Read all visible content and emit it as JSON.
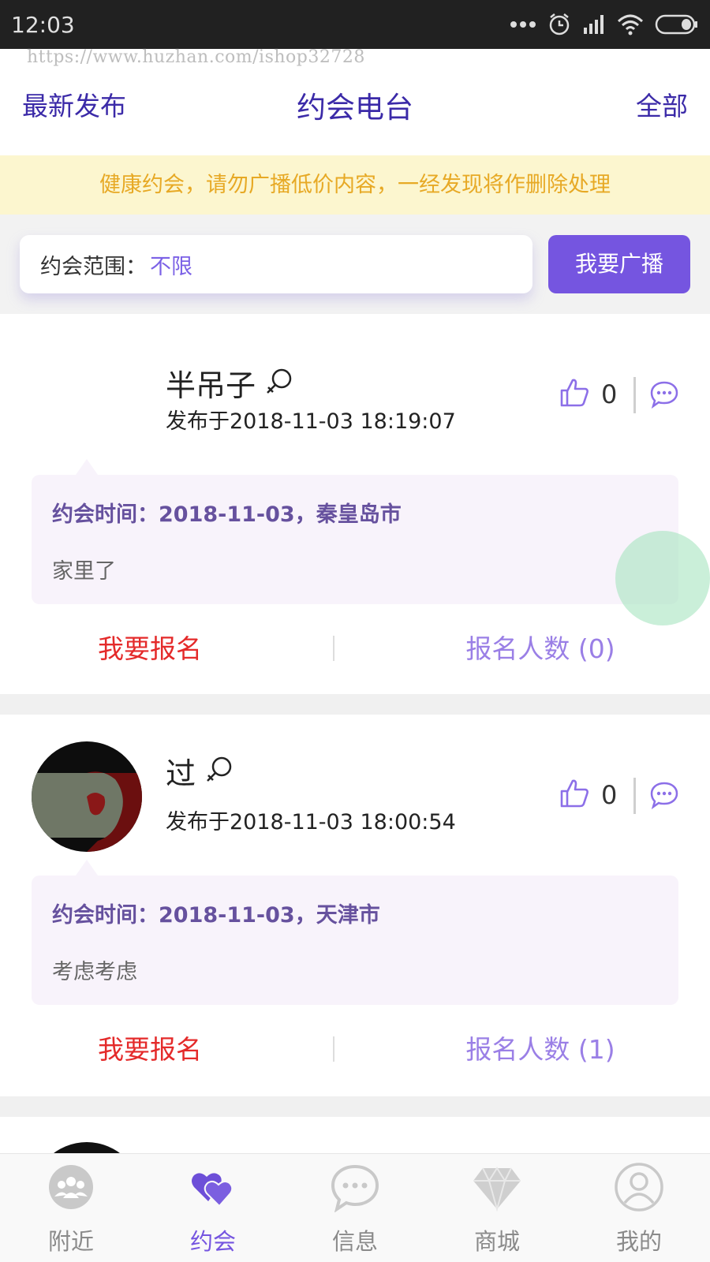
{
  "status_bar": {
    "time": "12:03",
    "icons": [
      "dots-icon",
      "alarm-icon",
      "signal-icon",
      "wifi-icon",
      "battery-icon"
    ]
  },
  "watermark": "https://www.huzhan.com/ishop32728",
  "header": {
    "left": "最新发布",
    "title": "约会电台",
    "right": "全部"
  },
  "notice": "健康约会，请勿广播低价内容，一经发现将作删除处理",
  "filter": {
    "label": "约会范围：",
    "value": "不限",
    "button": "我要广播"
  },
  "posts": [
    {
      "name": "半吊子",
      "gender_icon": "female-icon",
      "time": "发布于2018-11-03 18:19:07",
      "likes": "0",
      "meet": "约会时间：2018-11-03，秦皇岛市",
      "content": "家里了",
      "signup": "我要报名",
      "count": "报名人数 (0)",
      "has_avatar": false
    },
    {
      "name": "过",
      "gender_icon": "female-icon",
      "time": "发布于2018-11-03 18:00:54",
      "likes": "0",
      "meet": "约会时间：2018-11-03，天津市",
      "content": "考虑考虑",
      "signup": "我要报名",
      "count": "报名人数 (1)",
      "has_avatar": true
    }
  ],
  "tabs": [
    {
      "label": "附近",
      "icon": "nearby-icon",
      "active": false
    },
    {
      "label": "约会",
      "icon": "date-hearts-icon",
      "active": true
    },
    {
      "label": "信息",
      "icon": "message-icon",
      "active": false
    },
    {
      "label": "商城",
      "icon": "diamond-icon",
      "active": false
    },
    {
      "label": "我的",
      "icon": "profile-icon",
      "active": false
    }
  ],
  "colors": {
    "accent": "#7555e0",
    "title": "#3b2aa8",
    "signup": "#e42a2a",
    "notice_bg": "#fcf6cf",
    "notice_text": "#e7a925"
  }
}
